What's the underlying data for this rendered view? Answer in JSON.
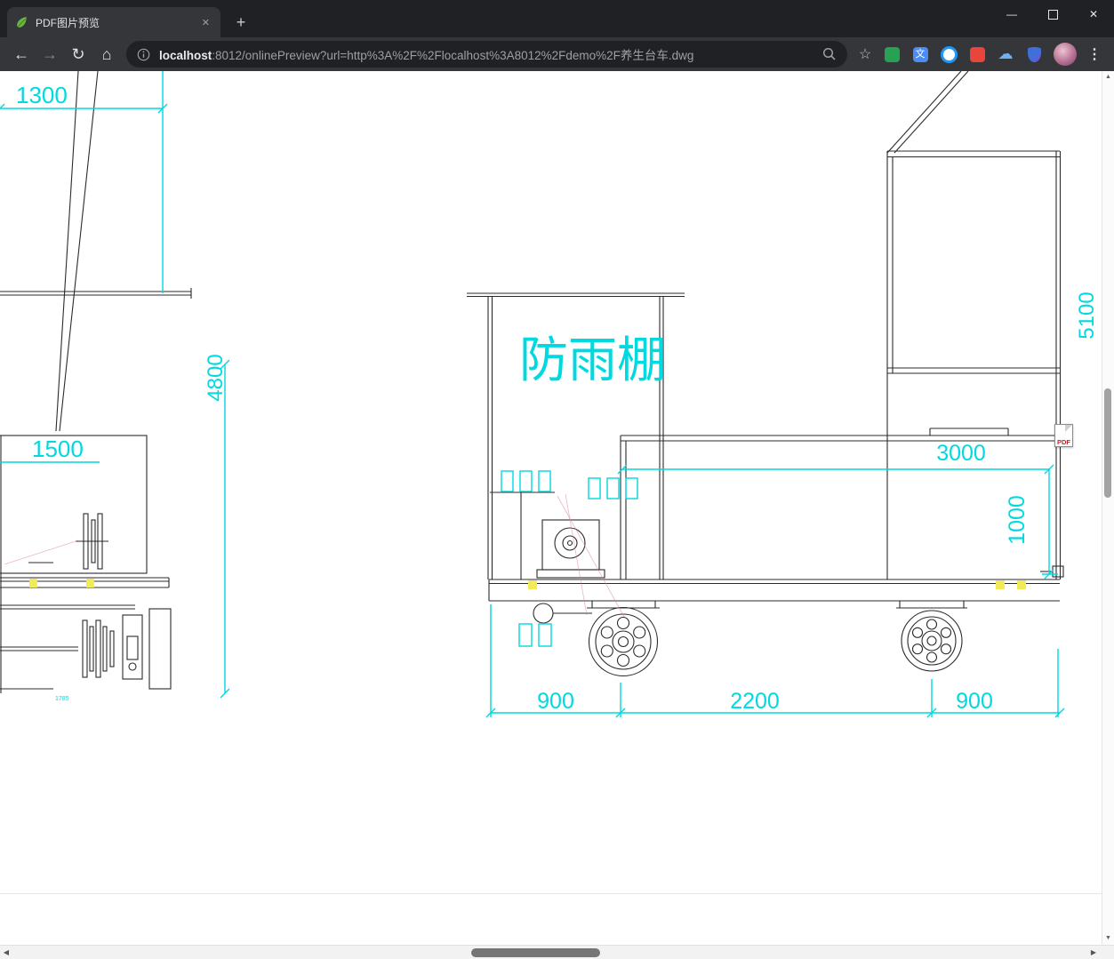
{
  "window": {
    "tab_title": "PDF图片预览"
  },
  "icons": {
    "back": "←",
    "forward": "→",
    "reload": "↻",
    "home": "⌂",
    "star": "☆",
    "menu": "⋮",
    "minimize": "—",
    "close": "✕",
    "tab_close": "✕",
    "new_tab": "+",
    "scroll_up": "▲",
    "scroll_down": "▼",
    "scroll_left": "◀",
    "scroll_right": "▶"
  },
  "urlbar": {
    "host": "localhost",
    "path": ":8012/onlinePreview?url=http%3A%2F%2Flocalhost%3A8012%2Fdemo%2F养生台车.dwg"
  },
  "drawing": {
    "shelter": "防雨棚",
    "pdf_badge": "PDF",
    "dims": {
      "d1300": "1300",
      "d4800": "4800",
      "d1500": "1500",
      "d5100": "5100",
      "d3000": "3000",
      "d1000": "1000",
      "d900l": "900",
      "d2200": "2200",
      "d900r": "900",
      "small_note": "1785"
    }
  },
  "colors": {
    "dim": "#00d9e0",
    "lines": "#2b2b2b",
    "highlight": "#f3ea57"
  }
}
